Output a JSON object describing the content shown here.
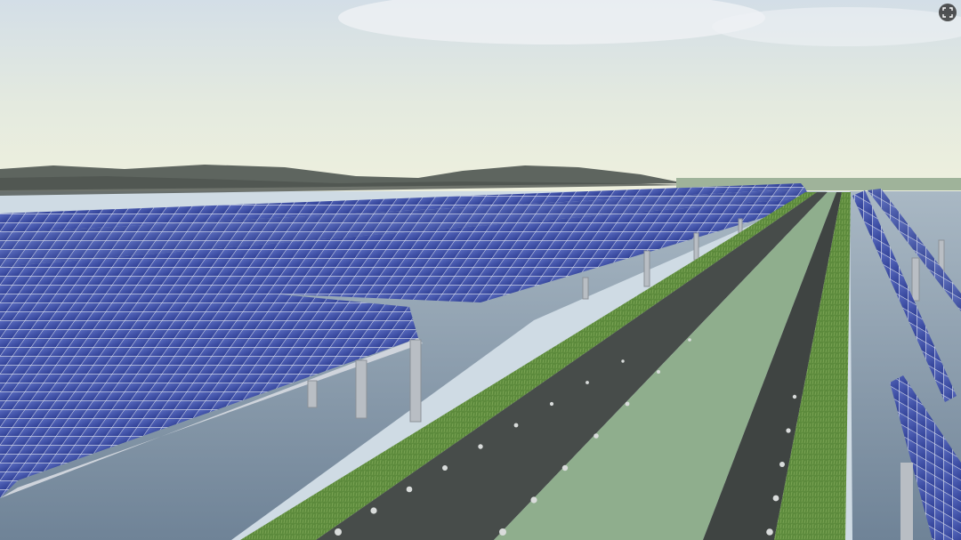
{
  "image": {
    "subject": "floating-solar-farm-render",
    "sky_top": "#d9e3ea",
    "sky_horizon": "#e9eede",
    "hill_color": "#59605a",
    "panel_color": "#3d4fa8",
    "panel_frame": "#d7dbe6",
    "water_color": "#8a9db0",
    "road_color": "#484d4b",
    "walkway_color": "#8ca98a",
    "grass_color": "#5f8a3e"
  },
  "controls": {
    "expand_icon": "expand-icon"
  }
}
